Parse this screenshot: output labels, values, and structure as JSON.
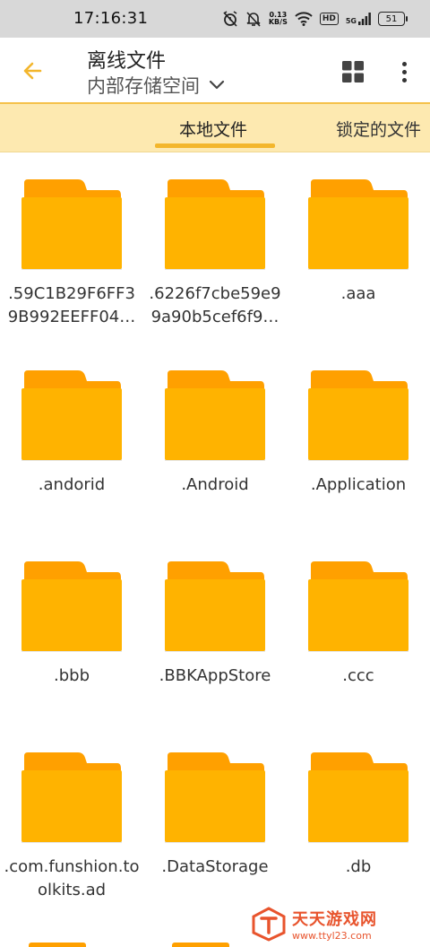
{
  "status_bar": {
    "time": "17:16:31",
    "net_speed_value": "0.13",
    "net_speed_unit": "KB/S",
    "hd": "HD",
    "signal": "5G",
    "battery": "51"
  },
  "header": {
    "back_icon": "back-arrow-icon",
    "title": "离线文件",
    "subtitle": "内部存储空间",
    "dropdown_icon": "chevron-down-icon",
    "view_icon": "grid-view-icon",
    "more_icon": "more-vertical-icon"
  },
  "tabs": [
    {
      "label": "本地文件",
      "active": true
    },
    {
      "label": "锁定的文件",
      "active": false
    }
  ],
  "colors": {
    "accent": "#F3B62C",
    "folder_body": "#FFB300",
    "folder_tab": "#FFA000",
    "tab_bar_bg": "#FDE9B0"
  },
  "folders": [
    {
      "name": ".59C1B29F6FF39B992EEFF04…",
      "line1": ".59C1B29F6FF3",
      "line2": "9B992EEFF04…"
    },
    {
      "name": ".6226f7cbe59e99a90b5cef6f9…",
      "line1": ".6226f7cbe59e9",
      "line2": "9a90b5cef6f9…"
    },
    {
      "name": ".aaa",
      "line1": ".aaa",
      "line2": ""
    },
    {
      "name": ".andorid",
      "line1": ".andorid",
      "line2": ""
    },
    {
      "name": ".Android",
      "line1": ".Android",
      "line2": ""
    },
    {
      "name": ".Application",
      "line1": ".Application",
      "line2": ""
    },
    {
      "name": ".bbb",
      "line1": ".bbb",
      "line2": ""
    },
    {
      "name": ".BBKAppStore",
      "line1": ".BBKAppStore",
      "line2": ""
    },
    {
      "name": ".ccc",
      "line1": ".ccc",
      "line2": ""
    },
    {
      "name": ".com.funshion.toolkits.ad",
      "line1": ".com.funshion.to",
      "line2": "olkits.ad"
    },
    {
      "name": ".DataStorage",
      "line1": ".DataStorage",
      "line2": ""
    },
    {
      "name": ".db",
      "line1": ".db",
      "line2": ""
    }
  ],
  "watermark": {
    "title": "天天游戏网",
    "url": "www.ttyl23.com"
  }
}
